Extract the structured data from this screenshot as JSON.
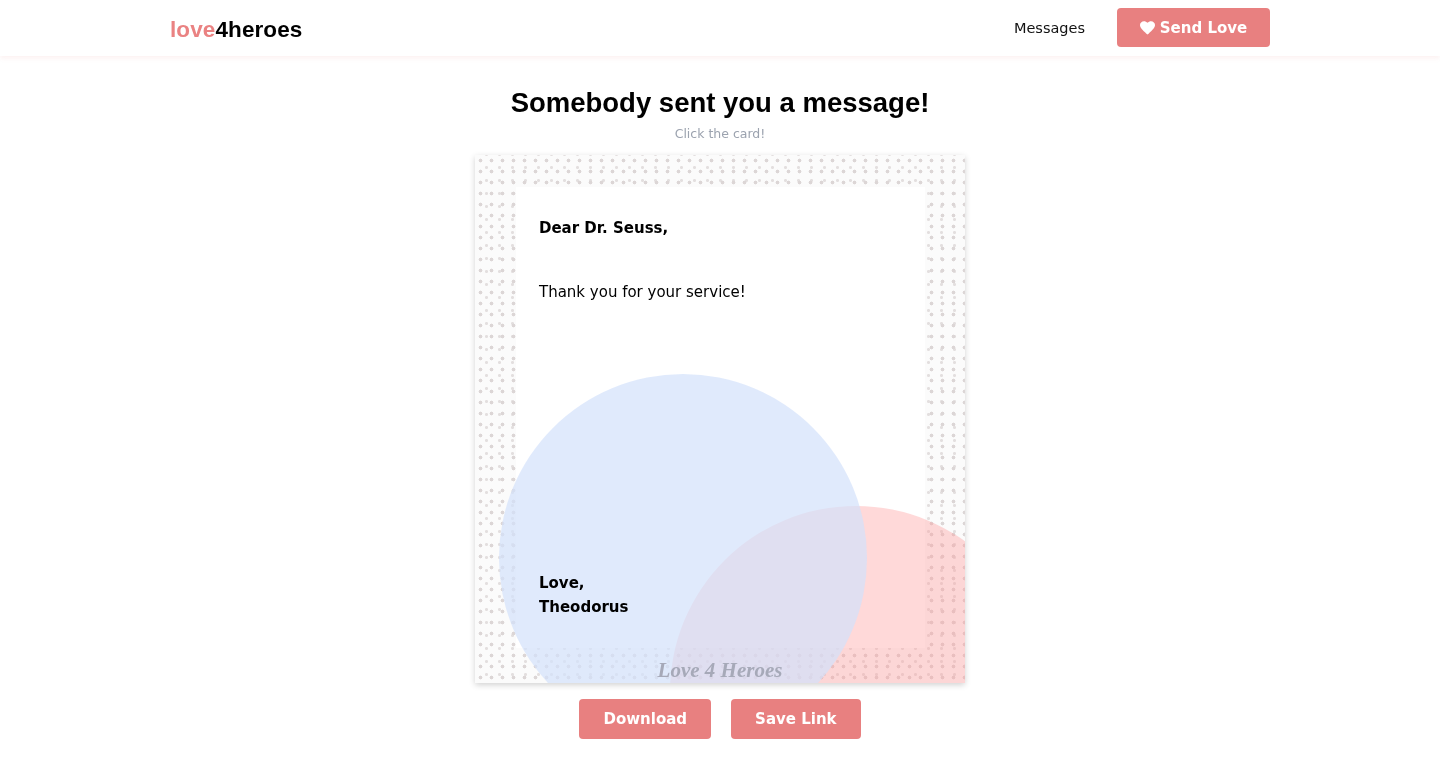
{
  "header": {
    "logo": {
      "accent": "love",
      "rest": "4heroes"
    },
    "nav": [
      {
        "label": "Messages"
      }
    ],
    "cta": {
      "label": "Send Love"
    }
  },
  "page": {
    "title": "Somebody sent you a message!",
    "subtitle": "Click the card!"
  },
  "card": {
    "greeting": "Dear Dr. Seuss,",
    "body": "Thank you for your service!",
    "closing": "Love,",
    "signature": "Theodorus",
    "brand_mark": "Love 4 Heroes"
  },
  "actions": [
    {
      "label": "Download"
    },
    {
      "label": "Save Link"
    }
  ]
}
